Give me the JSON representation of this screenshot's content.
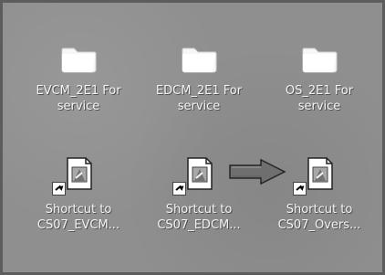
{
  "desktop": {
    "items": [
      {
        "label_line1": "EVCM_2E1 For",
        "label_line2": "service",
        "icon": "folder-icon"
      },
      {
        "label_line1": "EDCM_2E1 For",
        "label_line2": "service",
        "icon": "folder-icon"
      },
      {
        "label_line1": "OS_2E1 For",
        "label_line2": "service",
        "icon": "folder-icon"
      },
      {
        "label_line1": "Shortcut to",
        "label_line2": "CS07_EVCM...",
        "icon": "shortcut-file-icon"
      },
      {
        "label_line1": "Shortcut to",
        "label_line2": "CS07_EDCM...",
        "icon": "shortcut-file-icon"
      },
      {
        "label_line1": "Shortcut to",
        "label_line2": "CS07_Overs...",
        "icon": "shortcut-file-icon"
      }
    ]
  }
}
